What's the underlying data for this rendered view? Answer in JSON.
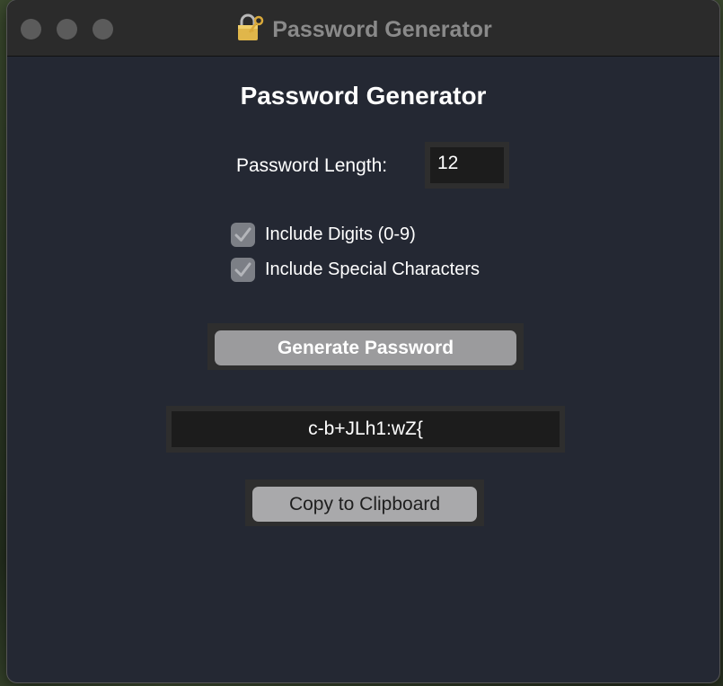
{
  "window": {
    "title": "Password Generator",
    "title_icon": "lock-with-key-icon"
  },
  "app": {
    "heading": "Password Generator",
    "length_label": "Password Length:",
    "length_value": "12",
    "options": [
      {
        "label": "Include Digits (0-9)",
        "checked": true
      },
      {
        "label": "Include Special Characters",
        "checked": true
      }
    ],
    "generate_label": "Generate Password",
    "generated_password": "c-b+JLh1:wZ{",
    "copy_label": "Copy to Clipboard"
  }
}
